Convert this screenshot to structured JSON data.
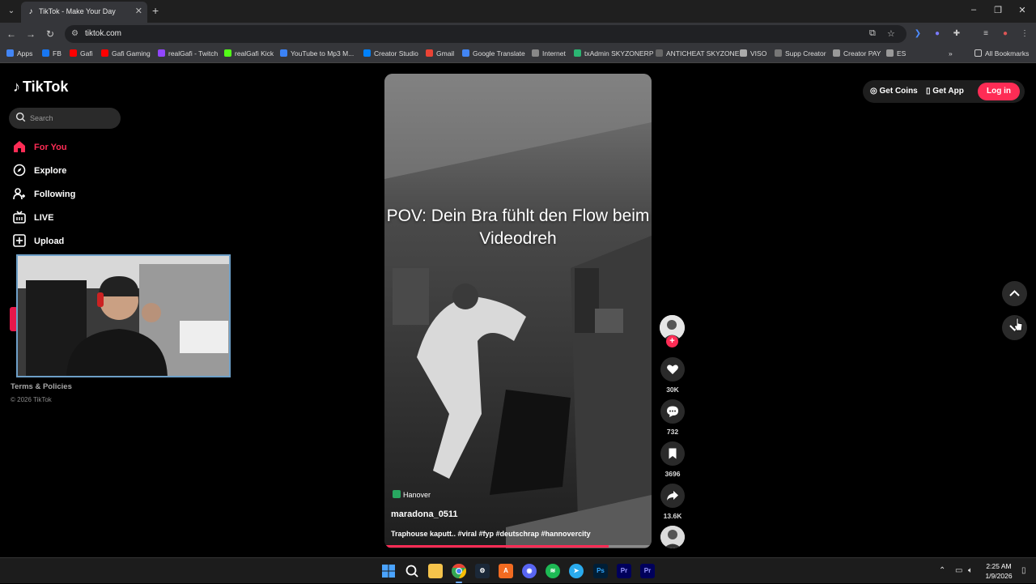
{
  "browser": {
    "tab_title": "TikTok - Make Your Day",
    "url": "tiktok.com",
    "bookmarks": [
      {
        "label": "Apps",
        "color": "#4285f4"
      },
      {
        "label": "FB",
        "color": "#1877f2"
      },
      {
        "label": "Gafi",
        "color": "#ff0000"
      },
      {
        "label": "Gafi Gaming",
        "color": "#ff0000"
      },
      {
        "label": "realGafi - Twitch",
        "color": "#9146ff"
      },
      {
        "label": "realGafi Kick",
        "color": "#53fc18"
      },
      {
        "label": "YouTube to Mp3 M...",
        "color": "#3b82f6"
      },
      {
        "label": "Creator Studio",
        "color": "#0081fb"
      },
      {
        "label": "Gmail",
        "color": "#ea4335"
      },
      {
        "label": "Google Translate",
        "color": "#4285f4"
      },
      {
        "label": "Internet",
        "color": "#888888"
      },
      {
        "label": "txAdmin SKYZONERP",
        "color": "#2bb673"
      },
      {
        "label": "ANTICHEAT SKYZONE",
        "color": "#666666"
      },
      {
        "label": "VISO",
        "color": "#aaaaaa"
      },
      {
        "label": "Supp Creator",
        "color": "#777777"
      },
      {
        "label": "Creator PAY",
        "color": "#999999"
      },
      {
        "label": "ES",
        "color": "#999999"
      }
    ],
    "all_bookmarks": "All Bookmarks"
  },
  "tiktok": {
    "logo": "TikTok",
    "search_placeholder": "Search",
    "nav": [
      {
        "label": "For You",
        "icon": "home-icon",
        "active": true
      },
      {
        "label": "Explore",
        "icon": "compass-icon",
        "active": false
      },
      {
        "label": "Following",
        "icon": "following-icon",
        "active": false
      },
      {
        "label": "LIVE",
        "icon": "live-icon",
        "active": false
      },
      {
        "label": "Upload",
        "icon": "upload-icon",
        "active": false
      }
    ],
    "footer_terms": "Terms & Policies",
    "footer_copyright": "© 2026 TikTok",
    "get_coins": "Get Coins",
    "get_app": "Get App",
    "login": "Log in",
    "accent": "#fe2c55"
  },
  "video": {
    "caption": "POV: Dein Bra fühlt den Flow beim Videodreh",
    "location": "Hanover",
    "author": "maradona_0511",
    "description": "Traphouse kaputt.. #viral #fyp #deutschrap #hannovercity",
    "progress": 0.84,
    "likes": "30K",
    "comments": "732",
    "saves": "3696",
    "shares": "13.6K"
  },
  "taskbar": {
    "time": "2:25 AM",
    "date": "1/9/2026"
  }
}
